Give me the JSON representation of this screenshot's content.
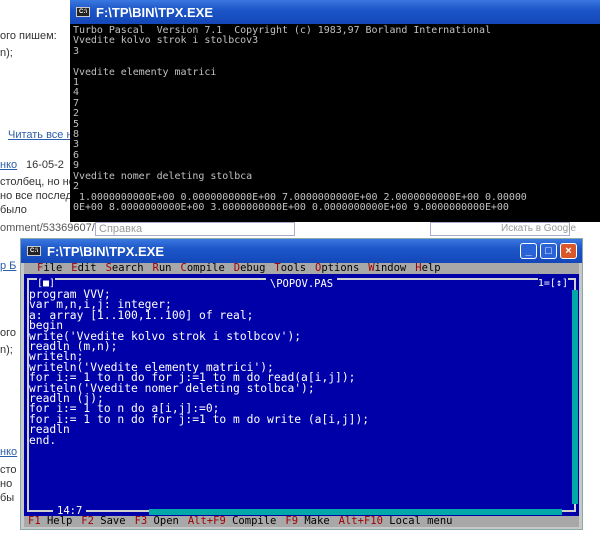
{
  "background_page": {
    "top_lines": [
      "ого пишем:",
      "n);"
    ],
    "read_all_link": "Читать все н",
    "author_link": "нко",
    "date": "16-05-2",
    "comment_lines": [
      "столбец, но не",
      "но все послед",
      "было"
    ],
    "url": "omment/53369607/",
    "help_text": "Справка",
    "search_placeholder": "Искать в Google",
    "lower_lines": [
      "р Б",
      "ого",
      "n);",
      "нко",
      "сто",
      "но",
      "бы"
    ]
  },
  "console_window": {
    "title": "F:\\TP\\BIN\\TPX.EXE",
    "lines": [
      "Turbo Pascal  Version 7.1  Copyright (c) 1983,97 Borland International",
      "Vvedite kolvo strok i stolbcov3",
      "3",
      "",
      "Vvedite elementy matrici",
      "1",
      "4",
      "7",
      "2",
      "5",
      "8",
      "3",
      "6",
      "9",
      "Vvedite nomer deleting stolbca",
      "2",
      " 1.0000000000E+00 0.0000000000E+00 7.0000000000E+00 2.0000000000E+00 0.00000",
      "0E+00 8.0000000000E+00 3.0000000000E+00 0.0000000000E+00 9.0000000000E+00"
    ]
  },
  "ide_window": {
    "title": "F:\\TP\\BIN\\TPX.EXE",
    "buttons": {
      "minimize": "_",
      "maximize": "□",
      "close": "×"
    },
    "menu": [
      "File",
      "Edit",
      "Search",
      "Run",
      "Compile",
      "Debug",
      "Tools",
      "Options",
      "Window",
      "Help"
    ],
    "editor": {
      "file_name": "\\POPOV.PAS",
      "close_box": "[■]",
      "window_number": "1=[↕]",
      "cursor_position": "14:7",
      "code": [
        "program VVV;",
        "var m,n,i,j: integer;",
        "a: array [1..100,1..100] of real;",
        "begin",
        "write('Vvedite kolvo strok i stolbcov');",
        "readln (m,n);",
        "writeln;",
        "writeln('Vvedite elementy matrici');",
        "for i:= 1 to n do for j:=1 to m do read(a[i,j]);",
        "writeln('Vvedite nomer deleting stolbca');",
        "readln (j);",
        "for i:= 1 to n do a[i,j]:=0;",
        "for i:= 1 to n do for j:=1 to m do write (a[i,j]);",
        "readln",
        "end."
      ]
    },
    "status_bar": [
      {
        "key": "F1",
        "label": "Help"
      },
      {
        "key": "F2",
        "label": "Save"
      },
      {
        "key": "F3",
        "label": "Open"
      },
      {
        "key": "Alt+F9",
        "label": "Compile"
      },
      {
        "key": "F9",
        "label": "Make"
      },
      {
        "key": "Alt+F10",
        "label": "Local menu"
      }
    ]
  },
  "colors": {
    "console_bg": "#000000",
    "editor_bg": "#0000a8",
    "menu_bg": "#a8a8a8",
    "hotkey": "#a00000",
    "titlebar": "#1d56c8"
  }
}
